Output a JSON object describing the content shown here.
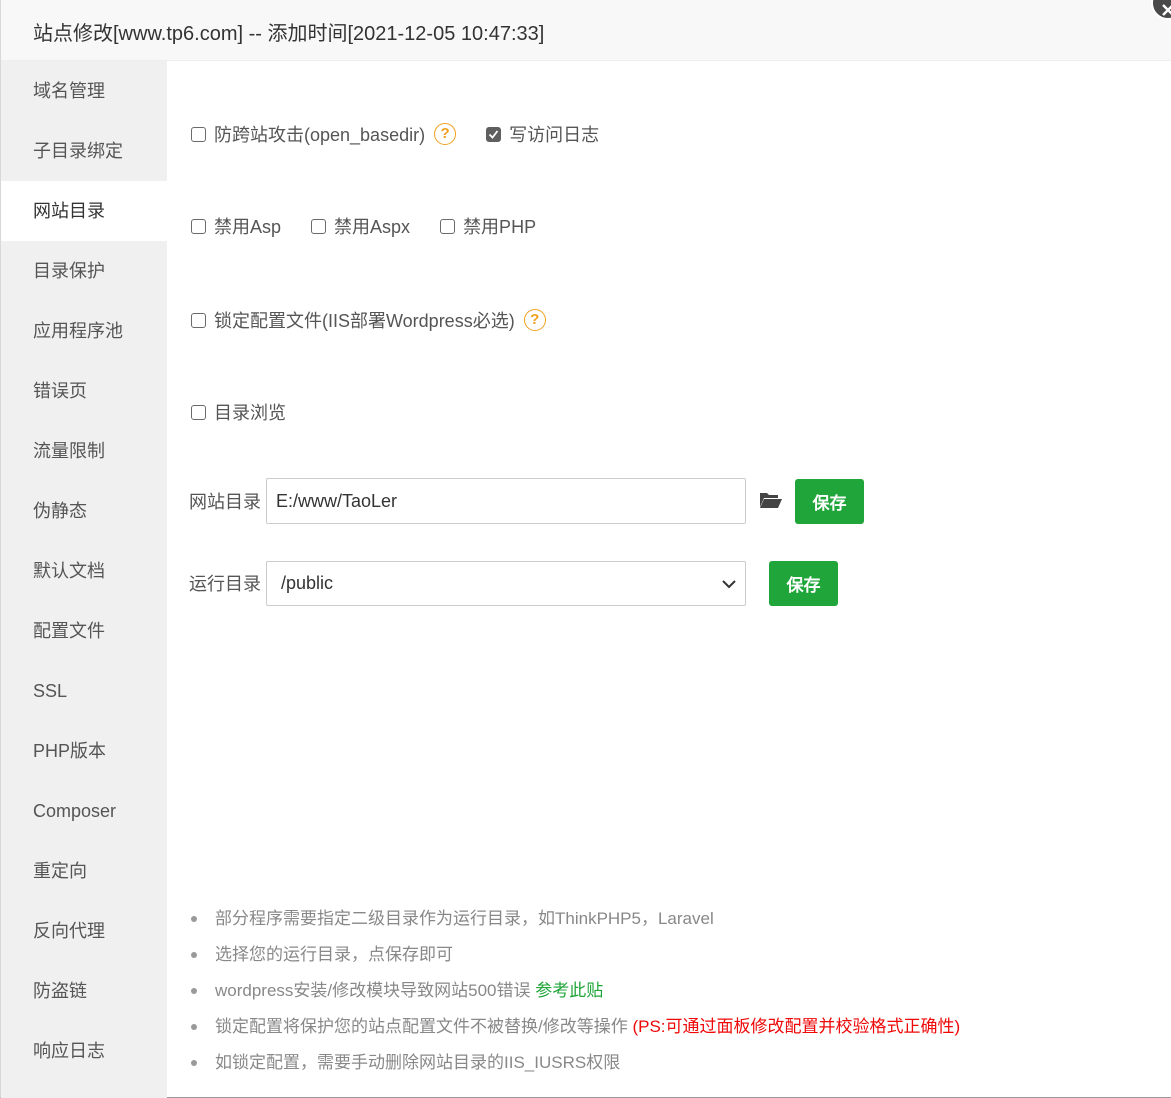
{
  "title": "站点修改[www.tp6.com] -- 添加时间[2021-12-05 10:47:33]",
  "sidebar": {
    "items": [
      {
        "label": "域名管理"
      },
      {
        "label": "子目录绑定"
      },
      {
        "label": "网站目录"
      },
      {
        "label": "目录保护"
      },
      {
        "label": "应用程序池"
      },
      {
        "label": "错误页"
      },
      {
        "label": "流量限制"
      },
      {
        "label": "伪静态"
      },
      {
        "label": "默认文档"
      },
      {
        "label": "配置文件"
      },
      {
        "label": "SSL"
      },
      {
        "label": "PHP版本"
      },
      {
        "label": "Composer"
      },
      {
        "label": "重定向"
      },
      {
        "label": "反向代理"
      },
      {
        "label": "防盗链"
      },
      {
        "label": "响应日志"
      }
    ],
    "active": "网站目录"
  },
  "options": {
    "open_basedir": {
      "label": "防跨站攻击(open_basedir)",
      "checked": false
    },
    "access_log": {
      "label": "写访问日志",
      "checked": true
    },
    "disable_asp": {
      "label": "禁用Asp",
      "checked": false
    },
    "disable_aspx": {
      "label": "禁用Aspx",
      "checked": false
    },
    "disable_php": {
      "label": "禁用PHP",
      "checked": false
    },
    "lock_config": {
      "label": "锁定配置文件(IIS部署Wordpress必选)",
      "checked": false
    },
    "dir_browse": {
      "label": "目录浏览",
      "checked": false
    },
    "help_glyph": "?"
  },
  "site_dir": {
    "label": "网站目录",
    "value": "E:/www/TaoLer",
    "save_label": "保存"
  },
  "run_dir": {
    "label": "运行目录",
    "selected": "/public",
    "save_label": "保存"
  },
  "tips": {
    "t1": "部分程序需要指定二级目录作为运行目录，如ThinkPHP5，Laravel",
    "t2": "选择您的运行目录，点保存即可",
    "t3": "wordpress安装/修改模块导致网站500错误 ",
    "t3_link": "参考此贴",
    "t4": "锁定配置将保护您的站点配置文件不被替换/修改等操作 ",
    "t4_warn": "(PS:可通过面板修改配置并校验格式正确性)",
    "t5": "如锁定配置，需要手动删除网站目录的IIS_IUSRS权限"
  },
  "colors": {
    "accent": "#20a53a",
    "warning": "#ef0808",
    "help": "#f0a020"
  }
}
